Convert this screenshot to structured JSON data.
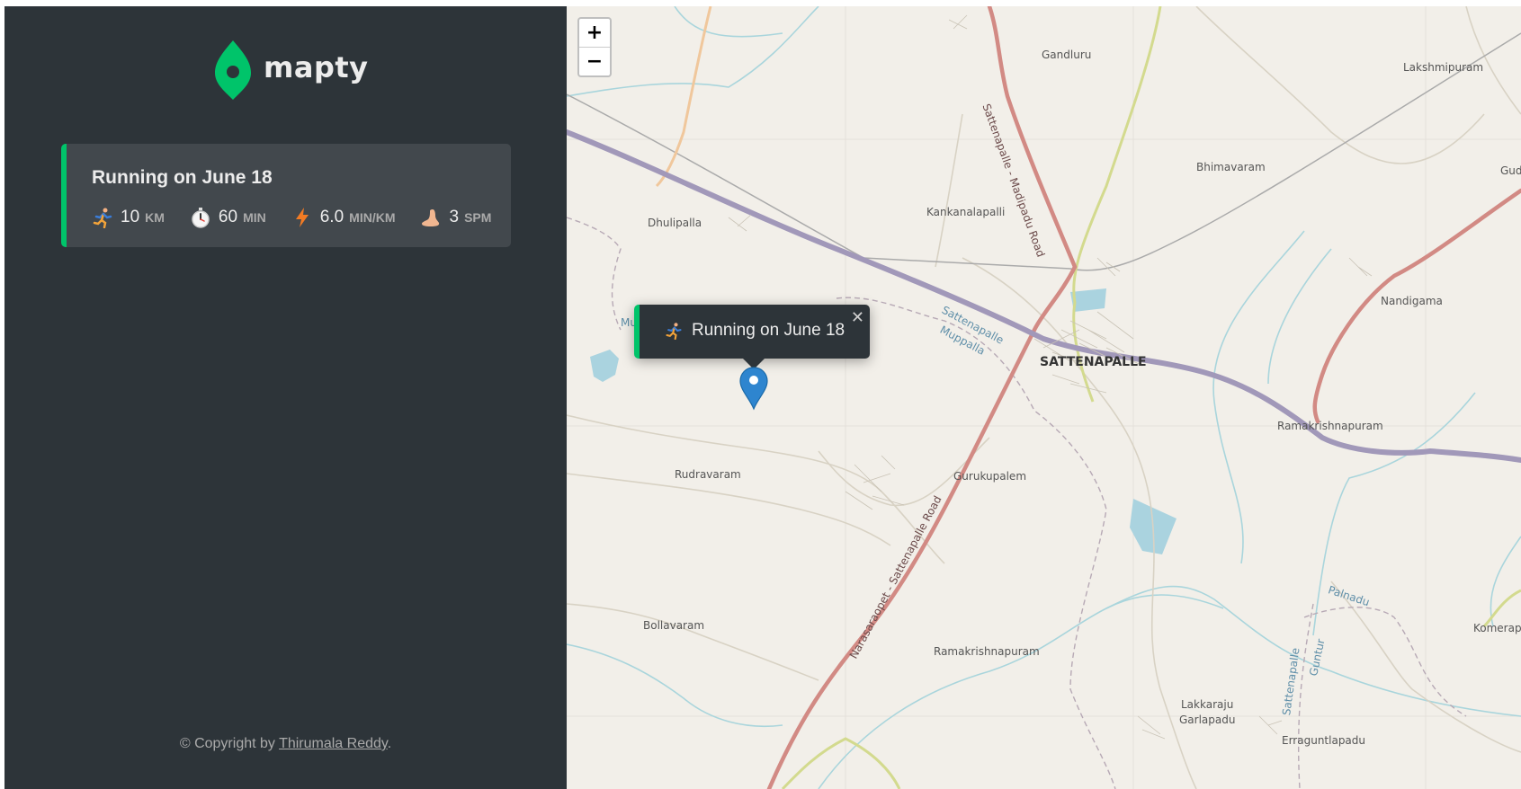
{
  "app": {
    "logo_text": "mapty",
    "brand_color": "#00c46a",
    "sidebar_bg": "#2d3439"
  },
  "workout": {
    "title": "Running on June 18",
    "distance": {
      "icon": "runner-icon",
      "value": "10",
      "unit": "km"
    },
    "duration": {
      "icon": "stopwatch-icon",
      "value": "60",
      "unit": "min"
    },
    "pace": {
      "icon": "lightning-icon",
      "value": "6.0",
      "unit": "min/km"
    },
    "cadence": {
      "icon": "foot-icon",
      "value": "3",
      "unit": "spm"
    }
  },
  "footer": {
    "prefix": "© Copyright by ",
    "author": "Thirumala Reddy",
    "suffix": "."
  },
  "map": {
    "zoom_in": "+",
    "zoom_out": "−",
    "popup": {
      "icon": "runner-icon",
      "text": "Running on June 18",
      "close": "✕"
    },
    "labels": {
      "gandluru": "Gandluru",
      "lakshmipuram": "Lakshmipuram",
      "bhimavaram": "Bhimavaram",
      "gud": "Gud",
      "kankanalapalli": "Kankanalapalli",
      "dhulipalla": "Dhulipalla",
      "sattenapalle_muppalla_1": "Sattenapalle",
      "sattenapalle_muppalla_2": "Muppalla",
      "sattenapalle_city": "SATTENAPALLE",
      "nandigama": "Nandigama",
      "ramakrishnapuram_east": "Ramakrishnapuram",
      "rudravaram": "Rudravaram",
      "gurukupalem": "Gurukupalem",
      "bollavaram": "Bollavaram",
      "ramakrishnapuram_south": "Ramakrishnapuram",
      "palnadu": "Palnadu",
      "komerapu": "Komerapu",
      "lakkaraju_1": "Lakkaraju",
      "lakkaraju_2": "Garlapadu",
      "erraguntlapadu": "Erraguntlapadu",
      "guntur": "Guntur",
      "sattenapalle_vertical": "Sattenapalle",
      "road_north": "Sattenapalle - Madipadu Road",
      "road_south": "Narasaraopet - Sattenapalle Road",
      "mu": "Mu"
    }
  }
}
